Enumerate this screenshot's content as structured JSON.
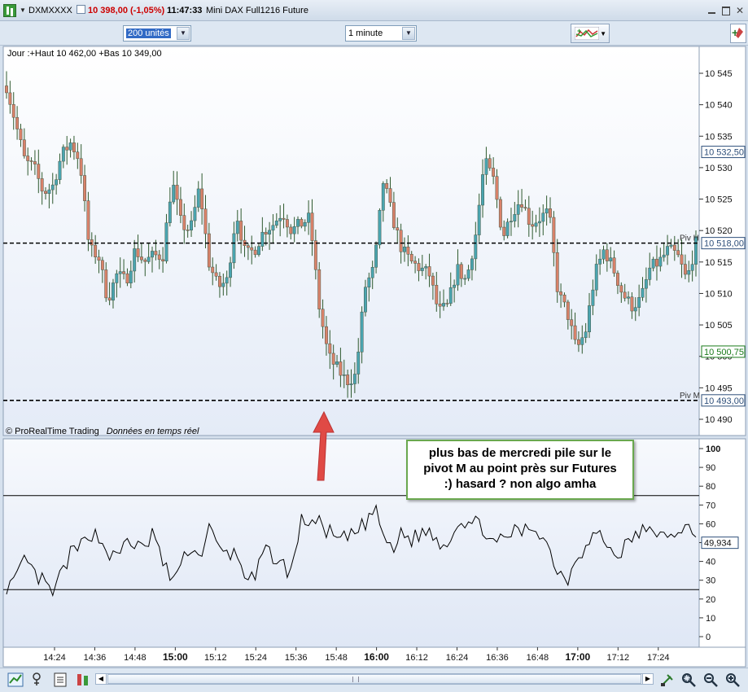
{
  "window": {
    "symbol": "DXMXXXX",
    "price_change": "10 398,00 (-1,05%)",
    "time": "11:47:33",
    "description": "Mini DAX Full1216 Future"
  },
  "toolbar": {
    "units_value": "200 unités",
    "interval_value": "1 minute"
  },
  "price_panel": {
    "header": "Jour :+Haut 10 462,00 +Bas 10 349,00",
    "copyright": "© ProRealTime Trading",
    "realtime_note": "Données en temps réel",
    "y_ticks": [
      "10 545",
      "10 540",
      "10 535",
      "10 530",
      "10 525",
      "10 520",
      "10 515",
      "10 510",
      "10 505",
      "10 500",
      "10 495",
      "10 490"
    ],
    "tags": [
      {
        "label": "10 532,50",
        "value": 10532.5,
        "color": "#2e4f7a"
      },
      {
        "label": "10 518,00",
        "value": 10518.0,
        "color": "#2e4f7a"
      },
      {
        "label": "10 500,75",
        "value": 10500.75,
        "color": "#1a7a1a"
      },
      {
        "label": "10 493,00",
        "value": 10493.0,
        "color": "#2e4f7a"
      }
    ],
    "pivots": [
      {
        "name": "Piv H",
        "value": 10518.0
      },
      {
        "name": "Piv M",
        "value": 10493.0
      }
    ]
  },
  "indicator_panel": {
    "y_ticks": [
      "100",
      "90",
      "80",
      "70",
      "60",
      "50",
      "40",
      "30",
      "20",
      "10",
      "0"
    ],
    "current_label": "49,934",
    "levels": [
      75,
      25
    ]
  },
  "x_axis": {
    "ticks": [
      {
        "label": "14:24",
        "bold": false
      },
      {
        "label": "14:36",
        "bold": false
      },
      {
        "label": "14:48",
        "bold": false
      },
      {
        "label": "15:00",
        "bold": true
      },
      {
        "label": "15:12",
        "bold": false
      },
      {
        "label": "15:24",
        "bold": false
      },
      {
        "label": "15:36",
        "bold": false
      },
      {
        "label": "15:48",
        "bold": false
      },
      {
        "label": "16:00",
        "bold": true
      },
      {
        "label": "16:12",
        "bold": false
      },
      {
        "label": "16:24",
        "bold": false
      },
      {
        "label": "16:36",
        "bold": false
      },
      {
        "label": "16:48",
        "bold": false
      },
      {
        "label": "17:00",
        "bold": true
      },
      {
        "label": "17:12",
        "bold": false
      },
      {
        "label": "17:24",
        "bold": false
      }
    ]
  },
  "annotation": {
    "lines": [
      "plus bas de mercredi pile sur le",
      "pivot M au point près sur Futures",
      ":) hasard ? non algo amha"
    ]
  },
  "colors": {
    "bull": "#4aa5b0",
    "bear": "#d9826a",
    "arrow": "#e04a45"
  },
  "chart_data": {
    "type": "candlestick",
    "close_path": [
      10543,
      10537,
      10531,
      10530,
      10526,
      10527,
      10532,
      10534,
      10531,
      10517,
      10516,
      10509,
      10513,
      10512,
      10517,
      10515,
      10516,
      10516,
      10528,
      10521,
      10520,
      10527,
      10515,
      10511,
      10512,
      10523,
      10516,
      10517,
      10520,
      10521,
      10523,
      10520,
      10521,
      10522,
      10508,
      10500,
      10498,
      10496,
      10497,
      10511,
      10514,
      10528,
      10522,
      10517,
      10515,
      10514,
      10513,
      10507,
      10508,
      10514,
      10512,
      10519,
      10531,
      10528,
      10519,
      10523,
      10525,
      10521,
      10522,
      10523,
      10510,
      10507,
      10501,
      10504,
      10513,
      10517,
      10514,
      10510,
      10508,
      10509,
      10514,
      10515,
      10517,
      10516,
      10512,
      10518
    ],
    "pivots": [
      {
        "name": "Piv H",
        "value": 10518.0
      },
      {
        "name": "Piv M",
        "value": 10493.0
      }
    ],
    "ylim": [
      10488,
      10546
    ],
    "oscillator": {
      "values": [
        27,
        29,
        41,
        33,
        29,
        22,
        34,
        44,
        47,
        56,
        53,
        45,
        41,
        52,
        49,
        45,
        57,
        38,
        31,
        37,
        49,
        41,
        59,
        46,
        44,
        44,
        33,
        29,
        46,
        43,
        38,
        34,
        61,
        62,
        60,
        56,
        51,
        52,
        55,
        60,
        68,
        55,
        43,
        57,
        51,
        55,
        56,
        51,
        49,
        62,
        61,
        60,
        58,
        48,
        51,
        56,
        55,
        59,
        56,
        47,
        35,
        30,
        44,
        47,
        55,
        52,
        43,
        46,
        52,
        56,
        55,
        57,
        49,
        58,
        59,
        50
      ],
      "ylim": [
        0,
        100
      ],
      "levels": [
        75,
        25
      ],
      "current": 49.934
    }
  }
}
